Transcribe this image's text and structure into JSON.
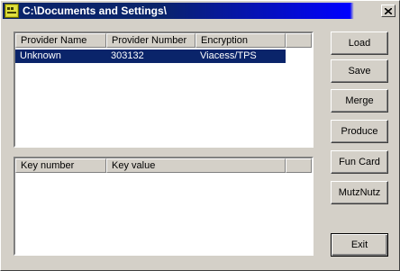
{
  "window": {
    "title": "C:\\Documents and Settings\\",
    "close_glyph": "✕",
    "icon": "app-icon"
  },
  "providers": {
    "columns": [
      "Provider Name",
      "Provider Number",
      "Encryption"
    ],
    "rows": [
      {
        "name": "Unknown",
        "number": "303132",
        "encryption": "Viacess/TPS",
        "selected": true
      }
    ]
  },
  "keys": {
    "columns": [
      "Key number",
      "Key value"
    ],
    "rows": []
  },
  "buttons": {
    "load": "Load",
    "save": "Save",
    "merge": "Merge",
    "produce": "Produce",
    "fun_card": "Fun Card",
    "mutznutz": "MutzNutz",
    "exit": "Exit"
  },
  "colors": {
    "title_active": "#0a246a",
    "selection": "#0a246a",
    "face": "#d4d0c8"
  }
}
